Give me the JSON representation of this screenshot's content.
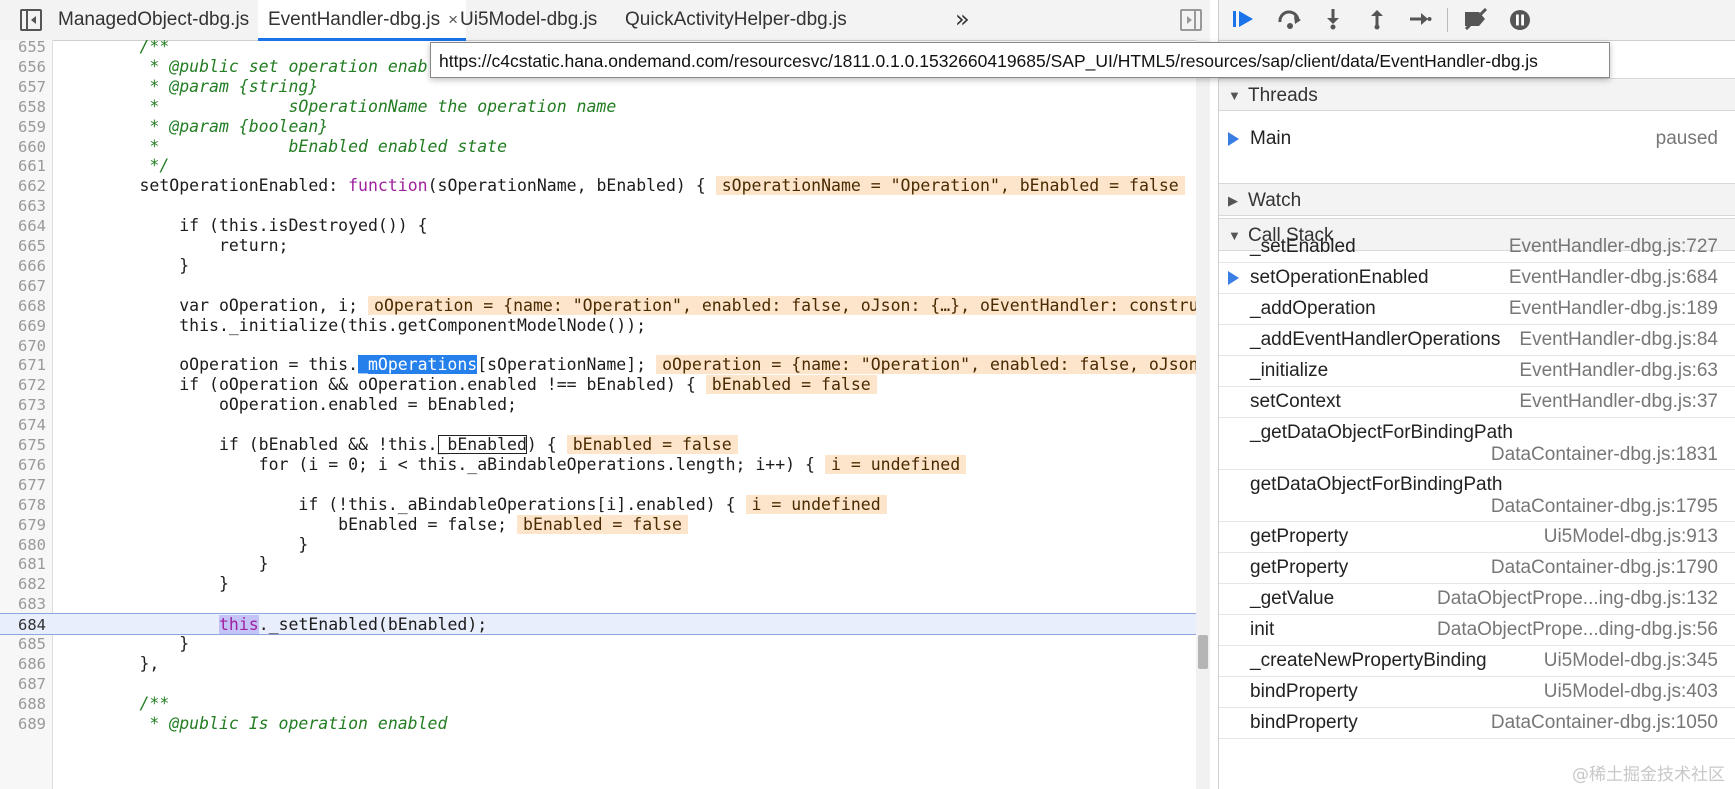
{
  "editor": {
    "tabs": [
      {
        "label": "ManagedObject-dbg.js"
      },
      {
        "label": "EventHandler-dbg.js",
        "close": "×"
      },
      {
        "label": "Ui5Model-dbg.js"
      },
      {
        "label": "QuickActivityHelper-dbg.js"
      }
    ],
    "overflow_glyph": "»",
    "tooltip_url": "https://c4cstatic.hana.ondemand.com/resourcesvc/1811.0.1.0.1532660419685/SAP_UI/HTML5/resources/sap/client/data/EventHandler-dbg.js",
    "lines": [
      {
        "n": "655",
        "code": "        /**"
      },
      {
        "n": "656",
        "code": "         * @public set operation enabled"
      },
      {
        "n": "657",
        "code": "         * @param {string}"
      },
      {
        "n": "658",
        "code": "         *             sOperationName the operation name"
      },
      {
        "n": "659",
        "code": "         * @param {boolean}"
      },
      {
        "n": "660",
        "code": "         *             bEnabled enabled state"
      },
      {
        "n": "661",
        "code": "         */"
      },
      {
        "n": "662",
        "pre": "        setOperationEnabled: ",
        "kw": "function",
        "post": "(sOperationName, bEnabled) {",
        "inline": "sOperationName = \"Operation\", bEnabled = false"
      },
      {
        "n": "663",
        "code": ""
      },
      {
        "n": "664",
        "code": "            if (this.isDestroyed()) {"
      },
      {
        "n": "665",
        "code": "                return;"
      },
      {
        "n": "666",
        "code": "            }"
      },
      {
        "n": "667",
        "code": ""
      },
      {
        "n": "668",
        "code": "            var oOperation, i;",
        "inline": "oOperation = {name: \"Operation\", enabled: false, oJson: {…}, oEventHandler: constructor}"
      },
      {
        "n": "669",
        "code": "            this._initialize(this.getComponentModelNode());"
      },
      {
        "n": "670",
        "code": ""
      },
      {
        "n": "671",
        "pre": "            oOperation = this.",
        "sel": "_mOperations",
        "post": "[sOperationName];",
        "inline": "oOperation = {name: \"Operation\", enabled: false, oJson: {…}}"
      },
      {
        "n": "672",
        "code": "            if (oOperation && oOperation.enabled !== bEnabled) {",
        "inline": "bEnabled = false"
      },
      {
        "n": "673",
        "code": "                oOperation.enabled = bEnabled;"
      },
      {
        "n": "674",
        "code": ""
      },
      {
        "n": "675",
        "pre": "                if (bEnabled && !this.",
        "box": "_bEnabled",
        "post": ") {",
        "inline": "bEnabled = false"
      },
      {
        "n": "676",
        "code": "                    for (i = 0; i < this._aBindableOperations.length; i++) {",
        "inline": "i = undefined"
      },
      {
        "n": "677",
        "code": ""
      },
      {
        "n": "678",
        "code": "                        if (!this._aBindableOperations[i].enabled) {",
        "inline": "i = undefined"
      },
      {
        "n": "679",
        "code": "                            bEnabled = false;",
        "inline": "bEnabled = false"
      },
      {
        "n": "680",
        "code": "                        }"
      },
      {
        "n": "681",
        "code": "                    }"
      },
      {
        "n": "682",
        "code": "                }"
      },
      {
        "n": "683",
        "code": ""
      },
      {
        "n": "684",
        "pre": "                ",
        "hl": "this",
        "post": "._setEnabled(bEnabled);",
        "current": true
      },
      {
        "n": "685",
        "code": "            }"
      },
      {
        "n": "686",
        "code": "        },"
      },
      {
        "n": "687",
        "code": ""
      },
      {
        "n": "688",
        "code": "        /**"
      },
      {
        "n": "689",
        "code": "         * @public Is operation enabled"
      }
    ]
  },
  "debugger": {
    "threads": {
      "label": "Threads",
      "items": [
        {
          "label": "Main",
          "status": "paused"
        }
      ]
    },
    "watch": {
      "label": "Watch"
    },
    "callstack": {
      "label": "Call Stack",
      "frames": [
        {
          "fn": "_setEnabled",
          "loc": "EventHandler-dbg.js:727"
        },
        {
          "fn": "setOperationEnabled",
          "loc": "EventHandler-dbg.js:684",
          "current": true
        },
        {
          "fn": "_addOperation",
          "loc": "EventHandler-dbg.js:189"
        },
        {
          "fn": "_addEventHandlerOperations",
          "loc": "EventHandler-dbg.js:84"
        },
        {
          "fn": "_initialize",
          "loc": "EventHandler-dbg.js:63"
        },
        {
          "fn": "setContext",
          "loc": "EventHandler-dbg.js:37"
        },
        {
          "fn": "_getDataObjectForBindingPath",
          "loc": "DataContainer-dbg.js:1831",
          "wrap": true
        },
        {
          "fn": "getDataObjectForBindingPath",
          "loc": "DataContainer-dbg.js:1795",
          "wrap": true
        },
        {
          "fn": "getProperty",
          "loc": "Ui5Model-dbg.js:913"
        },
        {
          "fn": "getProperty",
          "loc": "DataContainer-dbg.js:1790"
        },
        {
          "fn": "_getValue",
          "loc": "DataObjectPrope...ing-dbg.js:132"
        },
        {
          "fn": "init",
          "loc": "DataObjectPrope...ding-dbg.js:56"
        },
        {
          "fn": "_createNewPropertyBinding",
          "loc": "Ui5Model-dbg.js:345"
        },
        {
          "fn": "bindProperty",
          "loc": "Ui5Model-dbg.js:403"
        },
        {
          "fn": "bindProperty",
          "loc": "DataContainer-dbg.js:1050"
        }
      ]
    }
  },
  "watermark": "@稀土掘金技术社区",
  "colors": {
    "accent": "#1a73e8",
    "inline_value_bg": "#fde5cc",
    "current_line_bg": "#e9eefc"
  }
}
